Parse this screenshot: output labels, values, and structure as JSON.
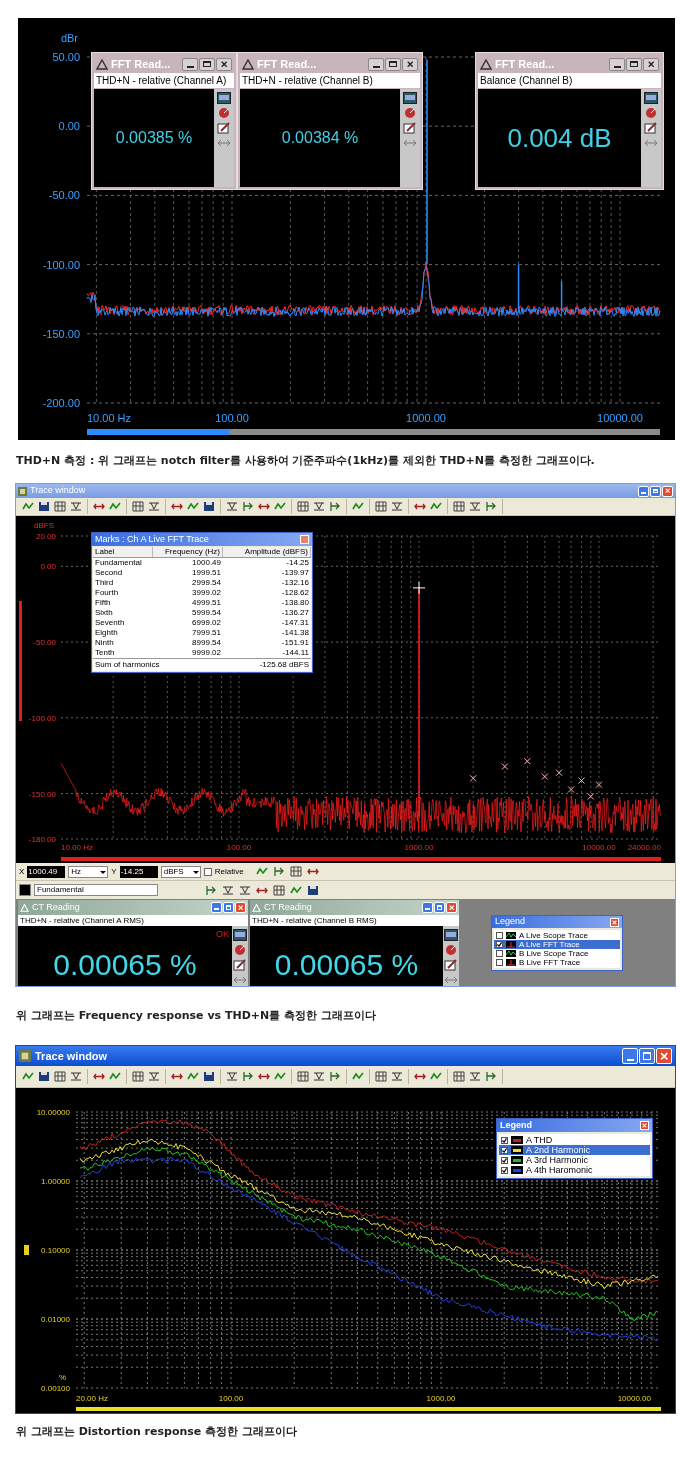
{
  "fft_panel": {
    "y_unit": "dBr",
    "y_labels": [
      "50.00",
      "0.00",
      "-50.00",
      "-100.00",
      "-150.00",
      "-200.00"
    ],
    "x_labels": [
      "10.00 Hz",
      "100.00",
      "1000.00",
      "10000.00"
    ],
    "readers": [
      {
        "title": "FFT Read...",
        "label": "THD+N - relative (Channel A)",
        "value": "0.00385 %",
        "kind": "normal"
      },
      {
        "title": "FFT Read...",
        "label": "THD+N - relative (Channel B)",
        "value": "0.00384 %",
        "kind": "normal"
      },
      {
        "title": "FFT Read...",
        "label": "Balance (Channel B)",
        "value": "0.004 dB",
        "kind": "large"
      }
    ]
  },
  "caption_1": "THD+N 측정 : 위 그래프는 notch filter를 사용하여 기준주파수(1kHz)를 제외한 THD+N를 측정한 그래프이다.",
  "trace_window_1": {
    "title": "Trace window",
    "y_unit": "dBFS",
    "y_labels": [
      "20.00",
      "0.00",
      "-50.00",
      "-100.00",
      "-150.00",
      "-180.00"
    ],
    "x_labels": [
      "10.00 Hz",
      "100.00",
      "1000.00",
      "10000.00",
      "24000.00"
    ],
    "marks": {
      "title": "Marks : Ch A Live FFT Trace",
      "columns": [
        "Label",
        "Frequency (Hz)",
        "Amplitude (dBFS)"
      ],
      "rows": [
        [
          "Fundamental",
          "1000.49",
          "-14.25"
        ],
        [
          "Second",
          "1999.51",
          "-139.97"
        ],
        [
          "Third",
          "2999.54",
          "-132.16"
        ],
        [
          "Fourth",
          "3999.02",
          "-128.62"
        ],
        [
          "Fifth",
          "4999.51",
          "-138.80"
        ],
        [
          "Sixth",
          "5999.54",
          "-136.27"
        ],
        [
          "Seventh",
          "6999.02",
          "-147.31"
        ],
        [
          "Eighth",
          "7999.51",
          "-141.38"
        ],
        [
          "Ninth",
          "8999.54",
          "-151.91"
        ],
        [
          "Tenth",
          "9999.02",
          "-144.11"
        ]
      ],
      "footer_label": "Sum of harmonics",
      "footer_value": "-125.68 dBFS"
    },
    "cursor": {
      "x_label": "X",
      "x_value": "1000.49",
      "x_unit": "Hz",
      "y_label": "Y",
      "y_value": "-14.25",
      "y_unit": "dBFS",
      "relative_label": "Relative",
      "relative_checked": false,
      "mark_name": "Fundamental"
    },
    "readings": [
      {
        "title": "CT Reading",
        "label": "THD+N - relative (Channel A RMS)",
        "status": "OK",
        "value": "0.00065 %"
      },
      {
        "title": "CT Reading",
        "label": "THD+N - relative (Channel B RMS)",
        "value": "0.00065 %"
      }
    ],
    "legend": {
      "title": "Legend",
      "items": [
        {
          "label": "A Live Scope Trace",
          "kind": "scope",
          "checked": false,
          "selected": false
        },
        {
          "label": "A Live FFT Trace",
          "kind": "fft",
          "checked": true,
          "selected": true
        },
        {
          "label": "B Live Scope Trace",
          "kind": "scope",
          "checked": false,
          "selected": false
        },
        {
          "label": "B Live FFT Trace",
          "kind": "fft",
          "checked": false,
          "selected": false
        }
      ]
    }
  },
  "caption_2": "위 그래프는 Frequency response vs THD+N를 측정한 그래프이다",
  "trace_window_2": {
    "title": "Trace window",
    "y_unit": "%",
    "y_labels": [
      "10.00000",
      "1.00000",
      "0.10000",
      "0.01000",
      "0.00100"
    ],
    "x_labels": [
      "20.00 Hz",
      "100.00",
      "1000.00",
      "10000.00"
    ],
    "legend": {
      "title": "Legend",
      "items": [
        {
          "label": "A  THD",
          "color": "#c02020",
          "checked": true,
          "selected": false
        },
        {
          "label": "A  2nd Harmonic",
          "color": "#e8e040",
          "checked": true,
          "selected": true
        },
        {
          "label": "A  3rd Harmonic",
          "color": "#20c020",
          "checked": true,
          "selected": false
        },
        {
          "label": "A  4th Haromonic",
          "color": "#2040e0",
          "checked": true,
          "selected": false
        }
      ]
    }
  },
  "caption_3": "위 그래프는 Distortion response 측정한 그래프이다"
}
